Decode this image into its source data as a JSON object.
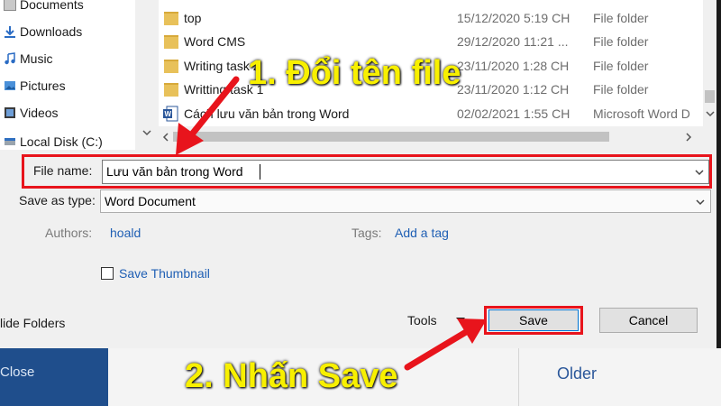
{
  "nav": {
    "items": [
      {
        "label": "Documents",
        "icon": "documents-icon"
      },
      {
        "label": "Downloads",
        "icon": "downloads-icon"
      },
      {
        "label": "Music",
        "icon": "music-icon"
      },
      {
        "label": "Pictures",
        "icon": "pictures-icon"
      },
      {
        "label": "Videos",
        "icon": "videos-icon"
      },
      {
        "label": "Local Disk (C:)",
        "icon": "disk-icon"
      }
    ]
  },
  "files": [
    {
      "name": "top",
      "date": "15/12/2020 5:19 CH",
      "type": "File folder",
      "icon": "folder-icon"
    },
    {
      "name": "Word CMS",
      "date": "29/12/2020 11:21 ...",
      "type": "File folder",
      "icon": "folder-icon"
    },
    {
      "name": "Writing task 2",
      "date": "23/11/2020 1:28 CH",
      "type": "File folder",
      "icon": "folder-icon"
    },
    {
      "name": "Writting task 1",
      "date": "23/11/2020 1:12 CH",
      "type": "File folder",
      "icon": "folder-icon"
    },
    {
      "name": "Cách lưu văn bản trong Word",
      "date": "02/02/2021 1:55 CH",
      "type": "Microsoft Word D",
      "icon": "word-doc-icon"
    }
  ],
  "form": {
    "file_name_label": "File name:",
    "file_name_value": "Lưu văn bản trong Word",
    "save_as_type_label": "Save as type:",
    "save_as_type_value": "Word Document",
    "authors_label": "Authors:",
    "authors_value": "hoald",
    "tags_label": "Tags:",
    "tags_value": "Add a tag",
    "thumbnail_label": "Save Thumbnail"
  },
  "footer": {
    "hide_folders": "lide Folders",
    "tools": "Tools",
    "save": "Save",
    "cancel": "Cancel"
  },
  "background": {
    "close": "Close",
    "older": "Older"
  },
  "annotations": {
    "step1": "1. Đổi tên file",
    "step2": "2. Nhấn Save"
  },
  "colors": {
    "highlight": "#e8141c",
    "annotation_text": "#f8f000",
    "link": "#1f5fb4"
  }
}
